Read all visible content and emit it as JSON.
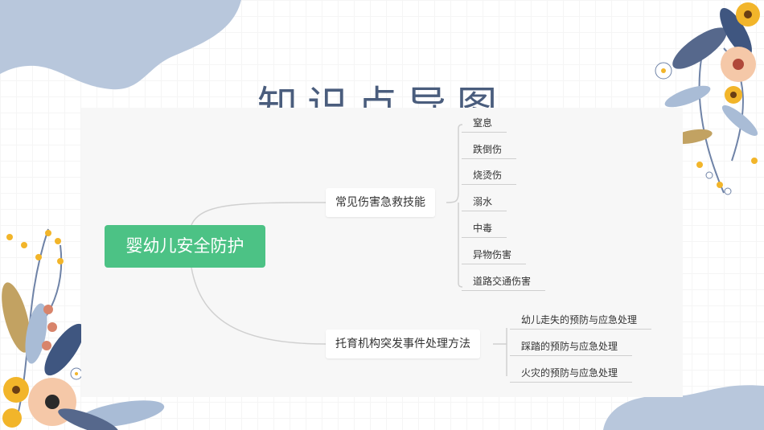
{
  "slide": {
    "title": "知识点导图"
  },
  "mindmap": {
    "root": "婴幼儿安全防护",
    "branches": [
      {
        "label": "常见伤害急救技能",
        "children": [
          "窒息",
          "跌倒伤",
          "烧烫伤",
          "溺水",
          "中毒",
          "异物伤害",
          "道路交通伤害"
        ]
      },
      {
        "label": "托育机构突发事件处理方法",
        "children": [
          "幼儿走失的预防与应急处理",
          "踩踏的预防与应急处理",
          "火灾的预防与应急处理"
        ]
      }
    ]
  },
  "colors": {
    "root_fill": "#4cc285",
    "title": "#4a5d7d",
    "blob": "#b8c7dc",
    "connector": "#d0d0d0"
  }
}
